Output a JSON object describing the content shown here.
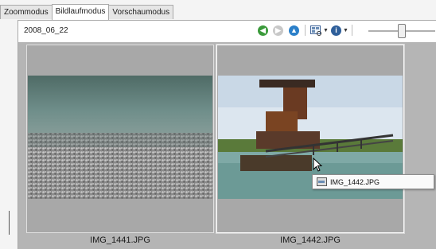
{
  "tabs": [
    {
      "label": "Zoommodus",
      "active": false
    },
    {
      "label": "Bildlaufmodus",
      "active": true
    },
    {
      "label": "Vorschaumodus",
      "active": false
    }
  ],
  "toolbar": {
    "folder_label": "2008_06_22",
    "icons": [
      "back-icon",
      "forward-icon",
      "up-icon",
      "view-options-icon",
      "info-icon",
      "zoom-slider"
    ]
  },
  "gallery": {
    "items": [
      {
        "filename": "IMG_1441.JPG",
        "selected": false
      },
      {
        "filename": "IMG_1442.JPG",
        "selected": true
      }
    ]
  },
  "tooltip": {
    "text": "IMG_1442.JPG"
  },
  "colors": {
    "accent_green": "#3a9a3a",
    "accent_blue": "#2a7fc9",
    "gallery_bg": "#b5b5b5"
  }
}
